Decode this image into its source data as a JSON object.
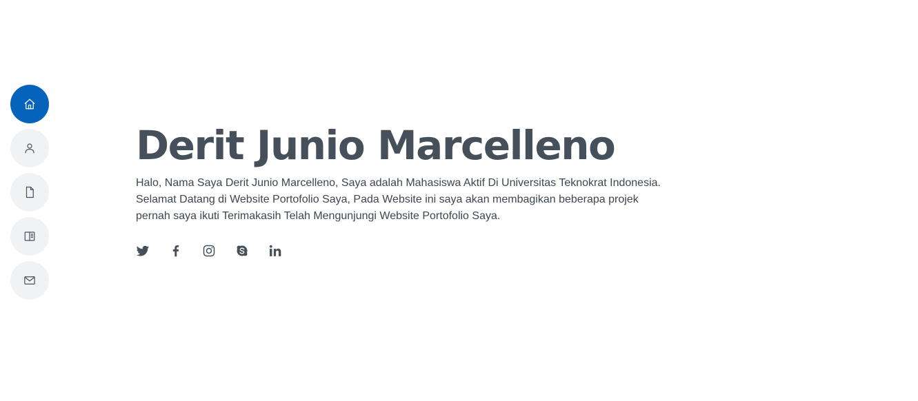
{
  "nav": {
    "items": [
      {
        "icon": "home-icon",
        "active": true
      },
      {
        "icon": "person-icon",
        "active": false
      },
      {
        "icon": "file-icon",
        "active": false
      },
      {
        "icon": "book-icon",
        "active": false
      },
      {
        "icon": "envelope-icon",
        "active": false
      }
    ]
  },
  "hero": {
    "title": "Derit Junio Marcelleno",
    "description_lines": [
      "Halo, Nama Saya Derit Junio Marcelleno, Saya adalah Mahasiswa Aktif Di Universitas Teknokrat Indonesia.",
      "Selamat Datang di Website Portofolio Saya, Pada Website ini saya akan membagikan beberapa projek",
      "pernah saya ikuti Terimakasih Telah Mengunjungi Website Portofolio Saya."
    ]
  },
  "socials": [
    "twitter-icon",
    "facebook-icon",
    "instagram-icon",
    "skype-icon",
    "linkedin-icon"
  ],
  "colors": {
    "accent": "#0563bb",
    "text": "#45505b",
    "nav_bg": "#f1f2f4"
  }
}
